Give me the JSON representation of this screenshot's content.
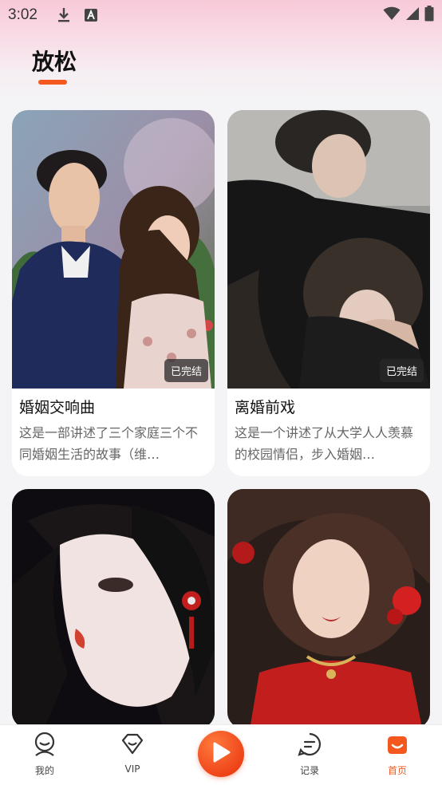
{
  "status_bar": {
    "time": "3:02"
  },
  "page": {
    "title": "放松"
  },
  "cards": [
    {
      "title": "婚姻交响曲",
      "description": "这是一部讲述了三个家庭三个不同婚姻生活的故事（维…",
      "badge": "已完结"
    },
    {
      "title": "离婚前戏",
      "description": "这是一个讲述了从大学人人羡慕的校园情侣，步入婚姻…",
      "badge": "已完结"
    },
    {
      "title": "",
      "description": "",
      "badge": ""
    },
    {
      "title": "",
      "description": "",
      "badge": ""
    }
  ],
  "bottom_nav": {
    "items": [
      {
        "label": "我的",
        "icon": "profile-icon"
      },
      {
        "label": "VIP",
        "icon": "vip-icon"
      },
      {
        "label": "记录",
        "icon": "history-icon"
      },
      {
        "label": "首页",
        "icon": "home-icon"
      }
    ],
    "active": "首页",
    "accent": "#f4581f"
  }
}
